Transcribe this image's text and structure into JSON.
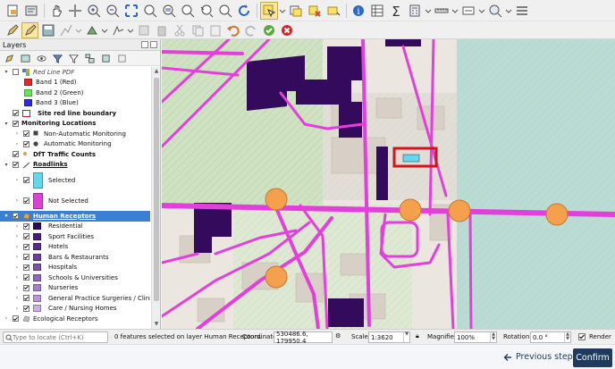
{
  "panel": {
    "title": "Layers"
  },
  "layers": [
    {
      "label": "Red Line PDF",
      "style": "i",
      "level": 0,
      "expand": "▾",
      "checked": false,
      "icon": "raster-icon"
    },
    {
      "label": "Band 1 (Red)",
      "level": 2,
      "swatch": "#e8262a"
    },
    {
      "label": "Band 2 (Green)",
      "level": 2,
      "swatch": "#5ee85a"
    },
    {
      "label": "Band 3 (Blue)",
      "level": 2,
      "swatch": "#2a2ae8"
    },
    {
      "label": "Site red line boundary",
      "style": "b",
      "level": 0,
      "checked": true,
      "swatch": "#ffffff",
      "border": "#d4141c"
    },
    {
      "label": "Monitoring Locations",
      "style": "b",
      "level": 0,
      "expand": "▾",
      "checked": true
    },
    {
      "label": "Non-Automatic Monitoring",
      "level": 1,
      "expand": "›",
      "checked": true,
      "icon": "square-marker-icon"
    },
    {
      "label": "Automatic Monitoring",
      "level": 1,
      "expand": "›",
      "checked": true,
      "icon": "circle-marker-icon"
    },
    {
      "label": "DfT Traffic Counts",
      "style": "b",
      "level": 0,
      "checked": true,
      "icon": "dot-marker-icon"
    },
    {
      "label": "Roadlinks",
      "style": "u",
      "level": 0,
      "expand": "▾",
      "checked": true,
      "icon": "line-icon"
    },
    {
      "label": "Selected",
      "level": 1,
      "expand": "›",
      "checked": true,
      "tall": true,
      "swatch": "#5fd8f0"
    },
    {
      "label": "Not Selected",
      "level": 1,
      "expand": "›",
      "checked": true,
      "tall": true,
      "swatch": "#e23fd8"
    },
    {
      "label": "Human Receptors",
      "style": "u",
      "level": 0,
      "expand": "▾",
      "checked": true,
      "selected": true,
      "icon": "polygon-icon"
    },
    {
      "label": "Residential",
      "level": 1,
      "expand": "›",
      "checked": true,
      "swatch": "#2e0a5c"
    },
    {
      "label": "Sport Facilities",
      "level": 1,
      "expand": "›",
      "checked": true,
      "swatch": "#4b1b7a"
    },
    {
      "label": "Hotels",
      "level": 1,
      "expand": "›",
      "checked": true,
      "swatch": "#5a2a8c"
    },
    {
      "label": "Bars & Restaurants",
      "level": 1,
      "expand": "›",
      "checked": true,
      "swatch": "#6c3e9e"
    },
    {
      "label": "Hospitals",
      "level": 1,
      "expand": "›",
      "checked": true,
      "swatch": "#7d52ad"
    },
    {
      "label": "Schools & Universities",
      "level": 1,
      "expand": "›",
      "checked": true,
      "swatch": "#9068c0"
    },
    {
      "label": "Nurseries",
      "level": 1,
      "expand": "›",
      "checked": true,
      "swatch": "#a57ed0"
    },
    {
      "label": "General Practice Surgeries / Clinics",
      "level": 1,
      "expand": "›",
      "checked": true,
      "swatch": "#b896dd"
    },
    {
      "label": "Care / Nursing Homes",
      "level": 1,
      "expand": "›",
      "checked": true,
      "swatch": "#c9aee8"
    },
    {
      "label": "Ecological Receptors",
      "style": "",
      "level": 0,
      "expand": "›",
      "checked": true,
      "icon": "eco-icon"
    }
  ],
  "status": {
    "locate_placeholder": "Type to locate (Ctrl+K)",
    "message": "0 features selected on layer Human Receptors.",
    "coordinate_label": "Coordinate",
    "coordinate": "530486.6, 179950.4",
    "scale_label": "Scale",
    "scale": "1:3620",
    "magnifier_label": "Magnifier",
    "magnifier": "100%",
    "rotation_label": "Rotation",
    "rotation": "0.0 °",
    "render_label": "Render"
  },
  "nav": {
    "previous": "Previous step",
    "confirm": "Confirm"
  },
  "colors": {
    "road": "#e43fdc",
    "receptor": "#330a5c",
    "marker": "#f5a04c",
    "selection": "#3b7fd4"
  }
}
